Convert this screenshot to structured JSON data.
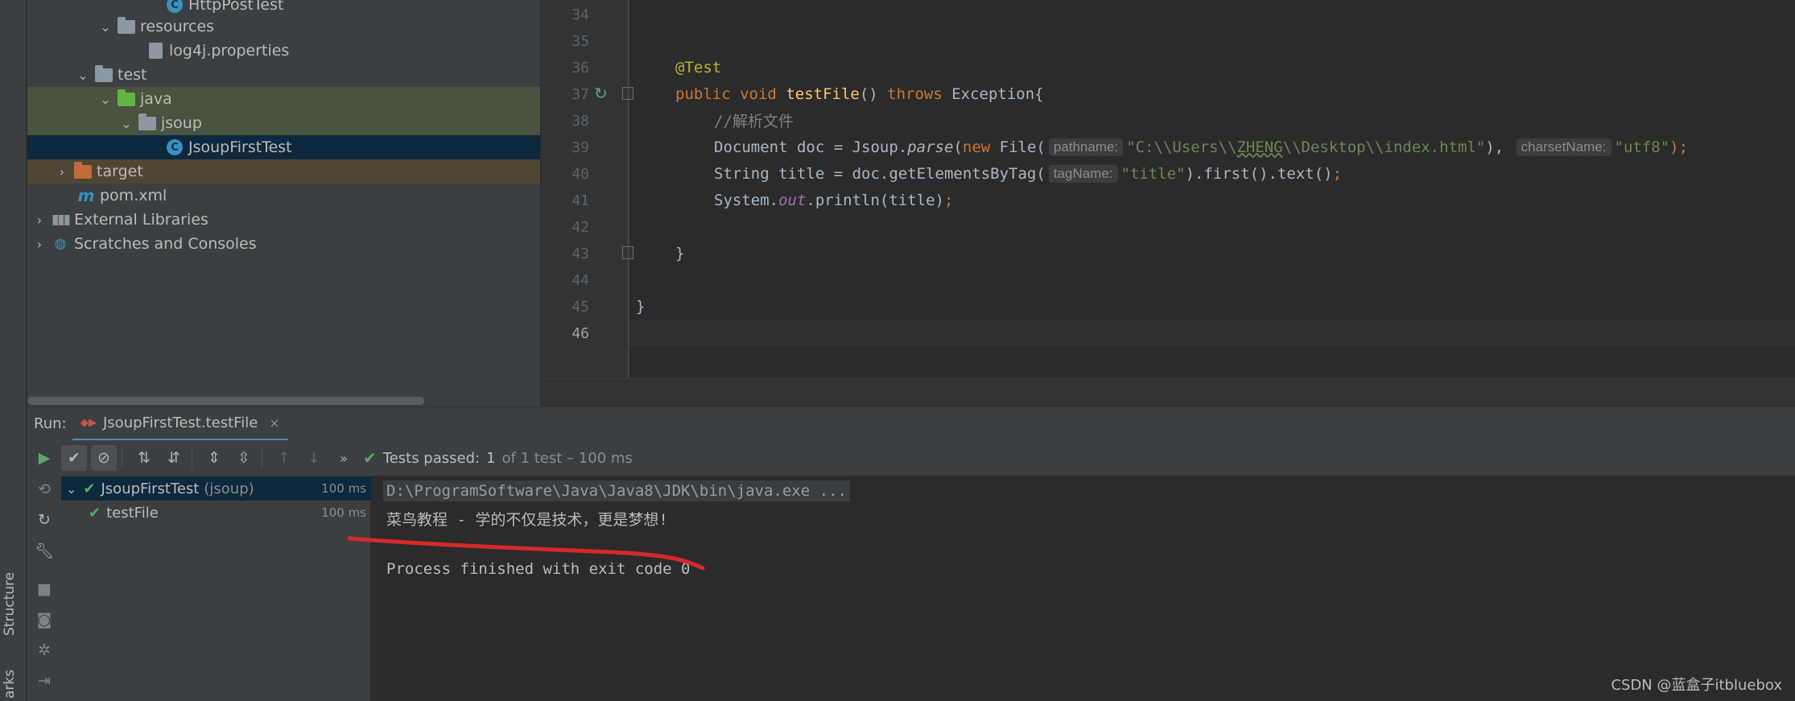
{
  "side_strip": {
    "structure_label": "Structure",
    "bookmarks_label": "arks"
  },
  "project_tree": {
    "rows": [
      {
        "name": "HttpPostTest"
      },
      {
        "name": "resources"
      },
      {
        "name": "log4j.properties"
      },
      {
        "name": "test"
      },
      {
        "name": "java"
      },
      {
        "name": "jsoup"
      },
      {
        "name": "JsoupFirstTest"
      },
      {
        "name": "target"
      },
      {
        "name": "pom.xml"
      },
      {
        "name": "External Libraries"
      },
      {
        "name": "Scratches and Consoles"
      }
    ]
  },
  "editor": {
    "line_numbers": [
      "34",
      "35",
      "36",
      "37",
      "38",
      "39",
      "40",
      "41",
      "42",
      "43",
      "44",
      "45",
      "46"
    ],
    "code": {
      "l36_annotation": "@Test",
      "l37_public": "public",
      "l37_void": "void",
      "l37_method": "testFile",
      "l37_parens": "() ",
      "l37_throws": "throws",
      "l37_rest": " Exception{",
      "l38_comment": "//解析文件",
      "l39_a": "Document doc = Jsoup.",
      "l39_parse": "parse",
      "l39_b": "(",
      "l39_new": "new",
      "l39_c": " File(",
      "l39_hint1": "pathname:",
      "l39_str1a": "\"C:\\\\Users\\\\",
      "l39_str1b": "ZHENG",
      "l39_str1c": "\\\\Desktop\\\\index.html\"",
      "l39_d": "), ",
      "l39_hint2": "charsetName:",
      "l39_str2": "\"utf8\"",
      "l39_e": ");",
      "l40_a": "String title = doc.getElementsByTag(",
      "l40_hint": "tagName:",
      "l40_str": "\"title\"",
      "l40_b": ").first().text()",
      "l40_semi": ";",
      "l41_a": "System.",
      "l41_out": "out",
      "l41_b": ".println(title)",
      "l41_semi": ";",
      "l43_brace": "}",
      "l45_brace": "}"
    }
  },
  "run_panel": {
    "label": "Run:",
    "tab_title": "JsoupFirstTest.testFile",
    "status_prefix": "Tests passed:",
    "status_count": "1",
    "status_suffix": "of 1 test – 100 ms",
    "tests": [
      {
        "name": "JsoupFirstTest",
        "package": "(jsoup)",
        "time": "100 ms"
      },
      {
        "name": "testFile",
        "time": "100 ms"
      }
    ]
  },
  "console": {
    "lines": [
      "D:\\ProgramSoftware\\Java\\Java8\\JDK\\bin\\java.exe ...",
      "菜鸟教程 - 学的不仅是技术，更是梦想!",
      "Process finished with exit code 0"
    ]
  },
  "watermark": "CSDN @蓝盒子itbluebox",
  "colors": {
    "keyword": "#cc7832",
    "string": "#6a8759",
    "annotation": "#bbb529",
    "method": "#ffc66d",
    "pass_green": "#59a869",
    "selection": "#0d293e",
    "red_mark": "#d42a2a"
  }
}
